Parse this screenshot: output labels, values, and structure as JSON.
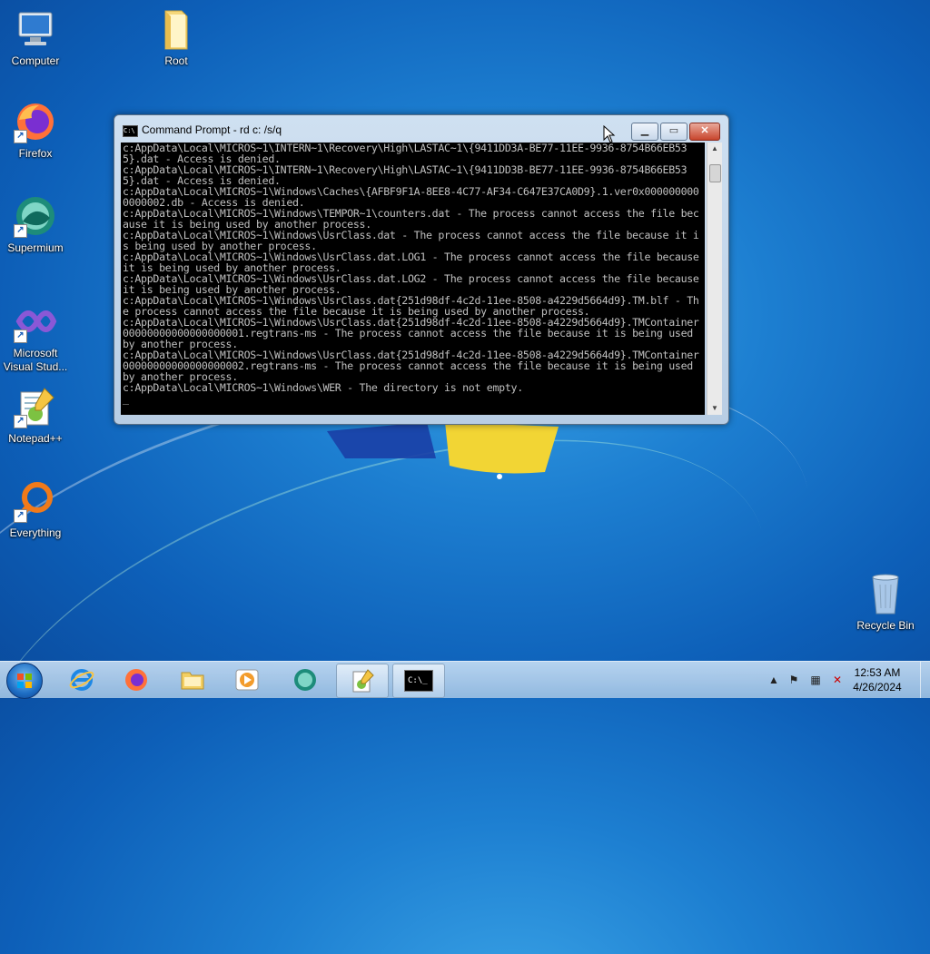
{
  "desktop": {
    "icons": [
      {
        "label": "Computer",
        "icon": "computer-icon"
      },
      {
        "label": "Root",
        "icon": "folder-icon"
      },
      {
        "label": "Firefox",
        "icon": "firefox-icon"
      },
      {
        "label": "Supermium",
        "icon": "supermium-icon"
      },
      {
        "label": "Microsoft Visual Stud...",
        "icon": "visual-studio-icon"
      },
      {
        "label": "Notepad++",
        "icon": "notepadpp-icon"
      },
      {
        "label": "Everything",
        "icon": "everything-icon"
      },
      {
        "label": "Recycle Bin",
        "icon": "recycle-bin-icon"
      }
    ]
  },
  "cmd": {
    "title": "Command Prompt - rd  c: /s/q",
    "icon_text": "C:\\",
    "output": "c:AppData\\Local\\MICROS~1\\INTERN~1\\Recovery\\High\\LASTAC~1\\{9411DD3A-BE77-11EE-9936-8754B66EB535}.dat - Access is denied.\nc:AppData\\Local\\MICROS~1\\INTERN~1\\Recovery\\High\\LASTAC~1\\{9411DD3B-BE77-11EE-9936-8754B66EB535}.dat - Access is denied.\nc:AppData\\Local\\MICROS~1\\Windows\\Caches\\{AFBF9F1A-8EE8-4C77-AF34-C647E37CA0D9}.1.ver0x0000000000000002.db - Access is denied.\nc:AppData\\Local\\MICROS~1\\Windows\\TEMPOR~1\\counters.dat - The process cannot access the file because it is being used by another process.\nc:AppData\\Local\\MICROS~1\\Windows\\UsrClass.dat - The process cannot access the file because it is being used by another process.\nc:AppData\\Local\\MICROS~1\\Windows\\UsrClass.dat.LOG1 - The process cannot access the file because it is being used by another process.\nc:AppData\\Local\\MICROS~1\\Windows\\UsrClass.dat.LOG2 - The process cannot access the file because it is being used by another process.\nc:AppData\\Local\\MICROS~1\\Windows\\UsrClass.dat{251d98df-4c2d-11ee-8508-a4229d5664d9}.TM.blf - The process cannot access the file because it is being used by another process.\nc:AppData\\Local\\MICROS~1\\Windows\\UsrClass.dat{251d98df-4c2d-11ee-8508-a4229d5664d9}.TMContainer00000000000000000001.regtrans-ms - The process cannot access the file because it is being used by another process.\nc:AppData\\Local\\MICROS~1\\Windows\\UsrClass.dat{251d98df-4c2d-11ee-8508-a4229d5664d9}.TMContainer00000000000000000002.regtrans-ms - The process cannot access the file because it is being used by another process.\nc:AppData\\Local\\MICROS~1\\Windows\\WER - The directory is not empty.\n_"
  },
  "taskbar": {
    "pinned": [
      "internet-explorer-icon",
      "firefox-icon",
      "explorer-folder-icon",
      "media-player-icon",
      "supermium-icon",
      "visual-studio-icon",
      "cmd-icon"
    ],
    "cmd_glyph": "C:\\_",
    "clock_time": "12:53 AM",
    "clock_date": "4/26/2024"
  }
}
